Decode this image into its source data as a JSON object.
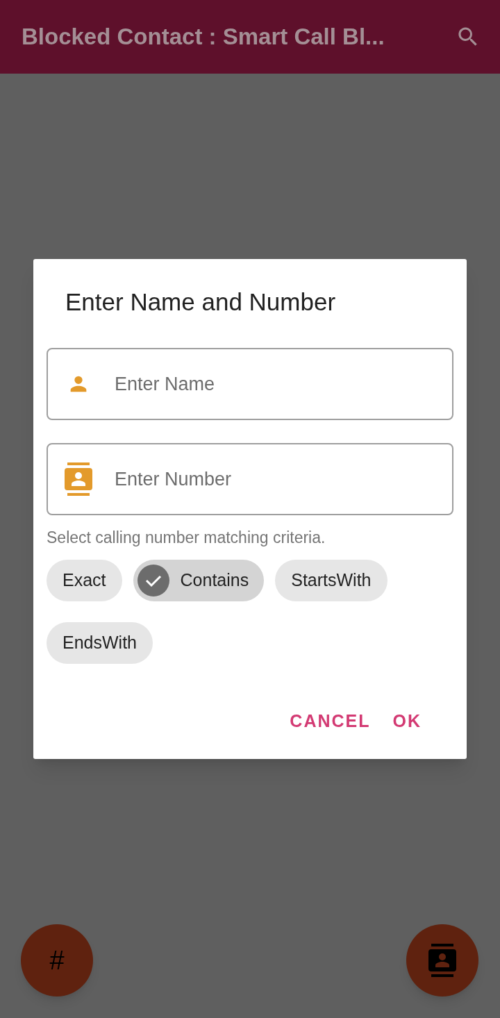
{
  "app_bar": {
    "title": "Blocked Contact : Smart Call Bl..."
  },
  "dialog": {
    "title": "Enter Name and Number",
    "fields": [
      {
        "kind": "person",
        "placeholder": "Enter Name"
      },
      {
        "kind": "contact",
        "placeholder": "Enter Number"
      }
    ],
    "helper": "Select calling number matching criteria.",
    "chips": [
      {
        "label": "Exact",
        "selected": false
      },
      {
        "label": "Contains",
        "selected": true
      },
      {
        "label": "StartsWith",
        "selected": false
      },
      {
        "label": "EndsWith",
        "selected": false
      }
    ],
    "buttons": [
      "CANCEL",
      "OK"
    ]
  },
  "fabs": [
    {
      "kind": "text",
      "label": "#"
    },
    {
      "kind": "contact"
    }
  ]
}
